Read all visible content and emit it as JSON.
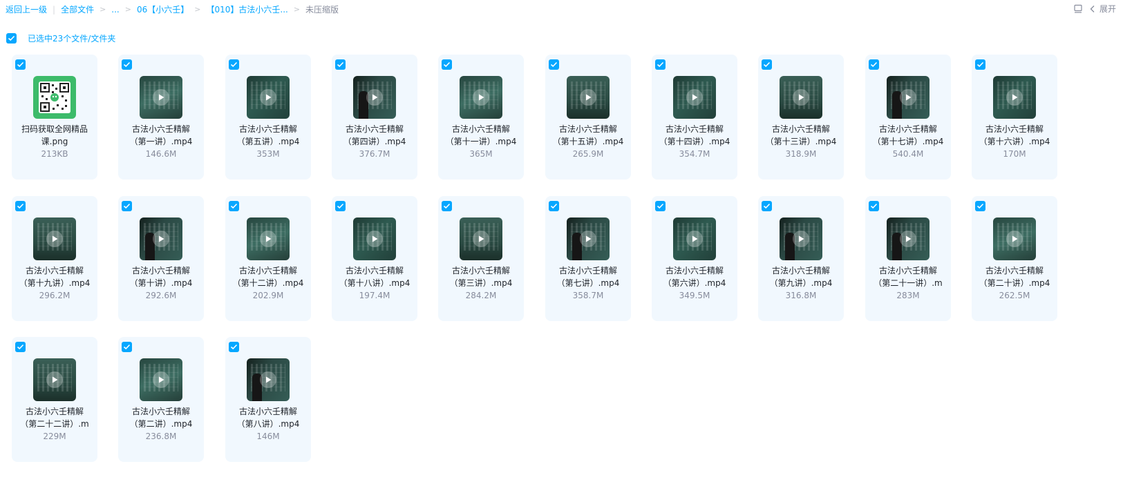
{
  "breadcrumb": {
    "back": "返回上一级",
    "all_files": "全部文件",
    "ellipsis": "...",
    "folder1": "06【小六壬】",
    "folder2": "【010】古法小六壬...",
    "current": "未压缩版"
  },
  "toolbar": {
    "expand_label": "展开"
  },
  "selection": {
    "label": "已选中23个文件/文件夹"
  },
  "files": [
    {
      "line1": "扫码获取全网精品",
      "line2": "课.png",
      "size": "213KB",
      "kind": "image"
    },
    {
      "line1": "古法小六壬精解",
      "line2": "（第一讲）.mp4",
      "size": "146.6M",
      "kind": "video",
      "variant": "v2"
    },
    {
      "line1": "古法小六壬精解",
      "line2": "（第五讲）.mp4",
      "size": "353M",
      "kind": "video",
      "variant": "v1"
    },
    {
      "line1": "古法小六壬精解",
      "line2": "（第四讲）.mp4",
      "size": "376.7M",
      "kind": "video",
      "variant": "v3"
    },
    {
      "line1": "古法小六壬精解",
      "line2": "（第十一讲）.mp4",
      "size": "365M",
      "kind": "video",
      "variant": "v2"
    },
    {
      "line1": "古法小六壬精解",
      "line2": "（第十五讲）.mp4",
      "size": "265.9M",
      "kind": "video",
      "variant": "v4"
    },
    {
      "line1": "古法小六壬精解",
      "line2": "（第十四讲）.mp4",
      "size": "354.7M",
      "kind": "video",
      "variant": "v1"
    },
    {
      "line1": "古法小六壬精解",
      "line2": "（第十三讲）.mp4",
      "size": "318.9M",
      "kind": "video",
      "variant": "v4"
    },
    {
      "line1": "古法小六壬精解",
      "line2": "（第十七讲）.mp4",
      "size": "540.4M",
      "kind": "video",
      "variant": "v3"
    },
    {
      "line1": "古法小六壬精解",
      "line2": "（第十六讲）.mp4",
      "size": "170M",
      "kind": "video",
      "variant": "v1"
    },
    {
      "line1": "古法小六壬精解",
      "line2": "（第十九讲）.mp4",
      "size": "296.2M",
      "kind": "video",
      "variant": "v4"
    },
    {
      "line1": "古法小六壬精解",
      "line2": "（第十讲）.mp4",
      "size": "292.6M",
      "kind": "video",
      "variant": "v3"
    },
    {
      "line1": "古法小六壬精解",
      "line2": "（第十二讲）.mp4",
      "size": "202.9M",
      "kind": "video",
      "variant": "v2"
    },
    {
      "line1": "古法小六壬精解",
      "line2": "（第十八讲）.mp4",
      "size": "197.4M",
      "kind": "video",
      "variant": "v1"
    },
    {
      "line1": "古法小六壬精解",
      "line2": "（第三讲）.mp4",
      "size": "284.2M",
      "kind": "video",
      "variant": "v4"
    },
    {
      "line1": "古法小六壬精解",
      "line2": "（第七讲）.mp4",
      "size": "358.7M",
      "kind": "video",
      "variant": "v3"
    },
    {
      "line1": "古法小六壬精解",
      "line2": "（第六讲）.mp4",
      "size": "349.5M",
      "kind": "video",
      "variant": "v1"
    },
    {
      "line1": "古法小六壬精解",
      "line2": "（第九讲）.mp4",
      "size": "316.8M",
      "kind": "video",
      "variant": "v3"
    },
    {
      "line1": "古法小六壬精解",
      "line2": "（第二十一讲）.m",
      "size": "283M",
      "kind": "video",
      "variant": "v3"
    },
    {
      "line1": "古法小六壬精解",
      "line2": "（第二十讲）.mp4",
      "size": "262.5M",
      "kind": "video",
      "variant": "v2"
    },
    {
      "line1": "古法小六壬精解",
      "line2": "（第二十二讲）.m",
      "size": "229M",
      "kind": "video",
      "variant": "v4"
    },
    {
      "line1": "古法小六壬精解",
      "line2": "（第二讲）.mp4",
      "size": "236.8M",
      "kind": "video",
      "variant": "v2"
    },
    {
      "line1": "古法小六壬精解",
      "line2": "（第八讲）.mp4",
      "size": "146M",
      "kind": "video",
      "variant": "v3"
    }
  ],
  "colors": {
    "accent": "#06a7ff",
    "card_bg": "#f1f8fe",
    "muted_text": "#878c9c"
  }
}
